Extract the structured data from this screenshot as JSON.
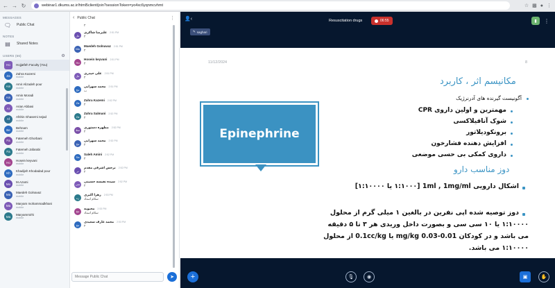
{
  "browser": {
    "url": "webinar1.dkums.ac.ir/html5client/join?sessionToken=yo4xc6yqnmcvhmt"
  },
  "nav": {
    "messages_label": "MESSAGES",
    "public_chat": "Public Chat",
    "notes_label": "NOTES",
    "shared_notes": "Shared Notes",
    "users_label": "USERS (66)"
  },
  "users": [
    {
      "initials": "Ho",
      "name": "Hojjatfeh Faculty (You)",
      "role": "",
      "color": "#7e5bb8"
    },
    {
      "initials": "Za",
      "name": "Zahra Kazemi",
      "role": "mobile",
      "color": "#2e6bbf"
    },
    {
      "initials": "Am",
      "name": "Amir Alizadeh pour",
      "role": "mobile",
      "color": "#2c7a8c"
    },
    {
      "initials": "Am",
      "name": "Amin Moradi",
      "role": "mobile",
      "color": "#3a62b4"
    },
    {
      "initials": "Ar",
      "name": "Arian Abbasi",
      "role": "mobile",
      "color": "#7e5bb8"
    },
    {
      "initials": "Af",
      "name": "Afshin Ghasemi nejad",
      "role": "mobile",
      "color": "#2d6f91"
    },
    {
      "initials": "Be",
      "name": "Behnam",
      "role": "mobile",
      "color": "#2e6bbf"
    },
    {
      "initials": "Fa",
      "name": "Fatemeh Ghorbani",
      "role": "mobile",
      "color": "#7a4fa8"
    },
    {
      "initials": "Fa",
      "name": "Fatemeh Jafarabi",
      "role": "mobile",
      "color": "#2c7a8c"
    },
    {
      "initials": "Ho",
      "name": "Hosein keyvani",
      "role": "mobile",
      "color": "#a3458f"
    },
    {
      "initials": "Kh",
      "name": "Khadijeh Khodadad pour",
      "role": "mobile",
      "color": "#2e6bbf"
    },
    {
      "initials": "Mo",
      "name": "M.Azami",
      "role": "mobile",
      "color": "#6a4fb0"
    },
    {
      "initials": "Ma",
      "name": "Maedeh Golnavaz",
      "role": "mobile",
      "color": "#3a62b4"
    },
    {
      "initials": "Ma",
      "name": "Maryam mohammadkhani",
      "role": "mobile",
      "color": "#7e5bb8"
    },
    {
      "initials": "Ma",
      "name": "Maryammirhi",
      "role": "mobile",
      "color": "#2c7a8c"
    }
  ],
  "chat": {
    "title": "Public Chat",
    "input_placeholder": "Message Public Chat",
    "messages": [
      {
        "initials": "",
        "name": "",
        "time": "",
        "text": "۲",
        "color": "#ffffff"
      },
      {
        "initials": "عل",
        "name": "علیرضا شاکری",
        "time": "2:51 PM",
        "text": "۲",
        "color": "#6a4fb0"
      },
      {
        "initials": "Ma",
        "name": "Maedeh Golnavaz",
        "time": "2:51 PM",
        "text": "۲",
        "color": "#3a62b4"
      },
      {
        "initials": "Ho",
        "name": "Hosein keyvani",
        "time": "2:51 PM",
        "text": "۲",
        "color": "#a3458f"
      },
      {
        "initials": "عل",
        "name": "علی حیدری",
        "time": "2:51 PM",
        "text": "۲",
        "color": "#7e5bb8"
      },
      {
        "initials": "مح",
        "name": "محمد سهرابی",
        "time": "2:51 PM",
        "text": "ب",
        "color": "#2e6bbf"
      },
      {
        "initials": "Za",
        "name": "Zahra Kazemi",
        "time": "2:52 PM",
        "text": "۲",
        "color": "#2e6bbf"
      },
      {
        "initials": "Za",
        "name": "Zahra Salmani",
        "time": "2:52 PM",
        "text": "۲",
        "color": "#2c7a8c"
      },
      {
        "initials": "مط",
        "name": "مطهره دستوری",
        "time": "2:52 PM",
        "text": "۲",
        "color": "#7a4fa8"
      },
      {
        "initials": "مح",
        "name": "محمد سهرابی",
        "time": "2:52 PM",
        "text": "۲",
        "color": "#3a62b4"
      },
      {
        "initials": "Sa",
        "name": "Saleh Amini",
        "time": "2:52 PM",
        "text": "۲",
        "color": "#2e6bbf"
      },
      {
        "initials": "نر",
        "name": "نرجس اشرفی مقدم",
        "time": "2:52 PM",
        "text": "۲",
        "color": "#6a4fb0"
      },
      {
        "initials": "سی",
        "name": "سیده نفیسه حسینی",
        "time": "2:52 PM",
        "text": "۲",
        "color": "#7e5bb8"
      },
      {
        "initials": "زه",
        "name": "زهرا اکبری",
        "time": "2:53 PM",
        "text": "سلام استاد",
        "color": "#2c7a8c"
      },
      {
        "initials": "مح",
        "name": "محبوبه",
        "time": "2:53 PM",
        "text": "سلام استاد",
        "color": "#a3458f"
      },
      {
        "initials": "مح",
        "name": "محمد عارف سعیدی",
        "time": "2:53 PM",
        "text": "۲",
        "color": "#2e6bbf"
      }
    ]
  },
  "presentation": {
    "title": "Resuscitation drugs",
    "timer": "06:55",
    "presenter": "saghari",
    "date": "11/12/2024",
    "page": "8",
    "heading1": "مکانیسم اثر ، کاربرد",
    "bullet_main": "آگونیست گیرنده های آدرنرژیک",
    "sub_bullets": [
      "مهمترین و اولین داروی CPR",
      "شوک آنافیلاکسی",
      "برونکودیلاتور",
      "افزایش دهنده فشارخون",
      "داروی کمکی بی حسی موضعی"
    ],
    "graphic_label": "Epinephrine",
    "heading2": "دوز مناسب دارو",
    "dose_bullet1": "اشکال دارویی  1ml , 1mg/ml  [۱:۱۰۰۰ یا ۱:۱۰۰۰۰]",
    "dose_lines": [
      "دوز توصیه شده اپی نفرین در بالغین ۱ میلی گرم از محلول",
      "۱:۱۰۰۰۰ یا ۱۰ سی سی و بصورت داخل وریدی هر ۳ تا ۵ دقیقه",
      "می باشد و در کودکان 0.01-0.03 mg/kg یا 0.1cc/kg از محلول",
      "۱:۱۰۰۰۰ می باشد."
    ]
  }
}
